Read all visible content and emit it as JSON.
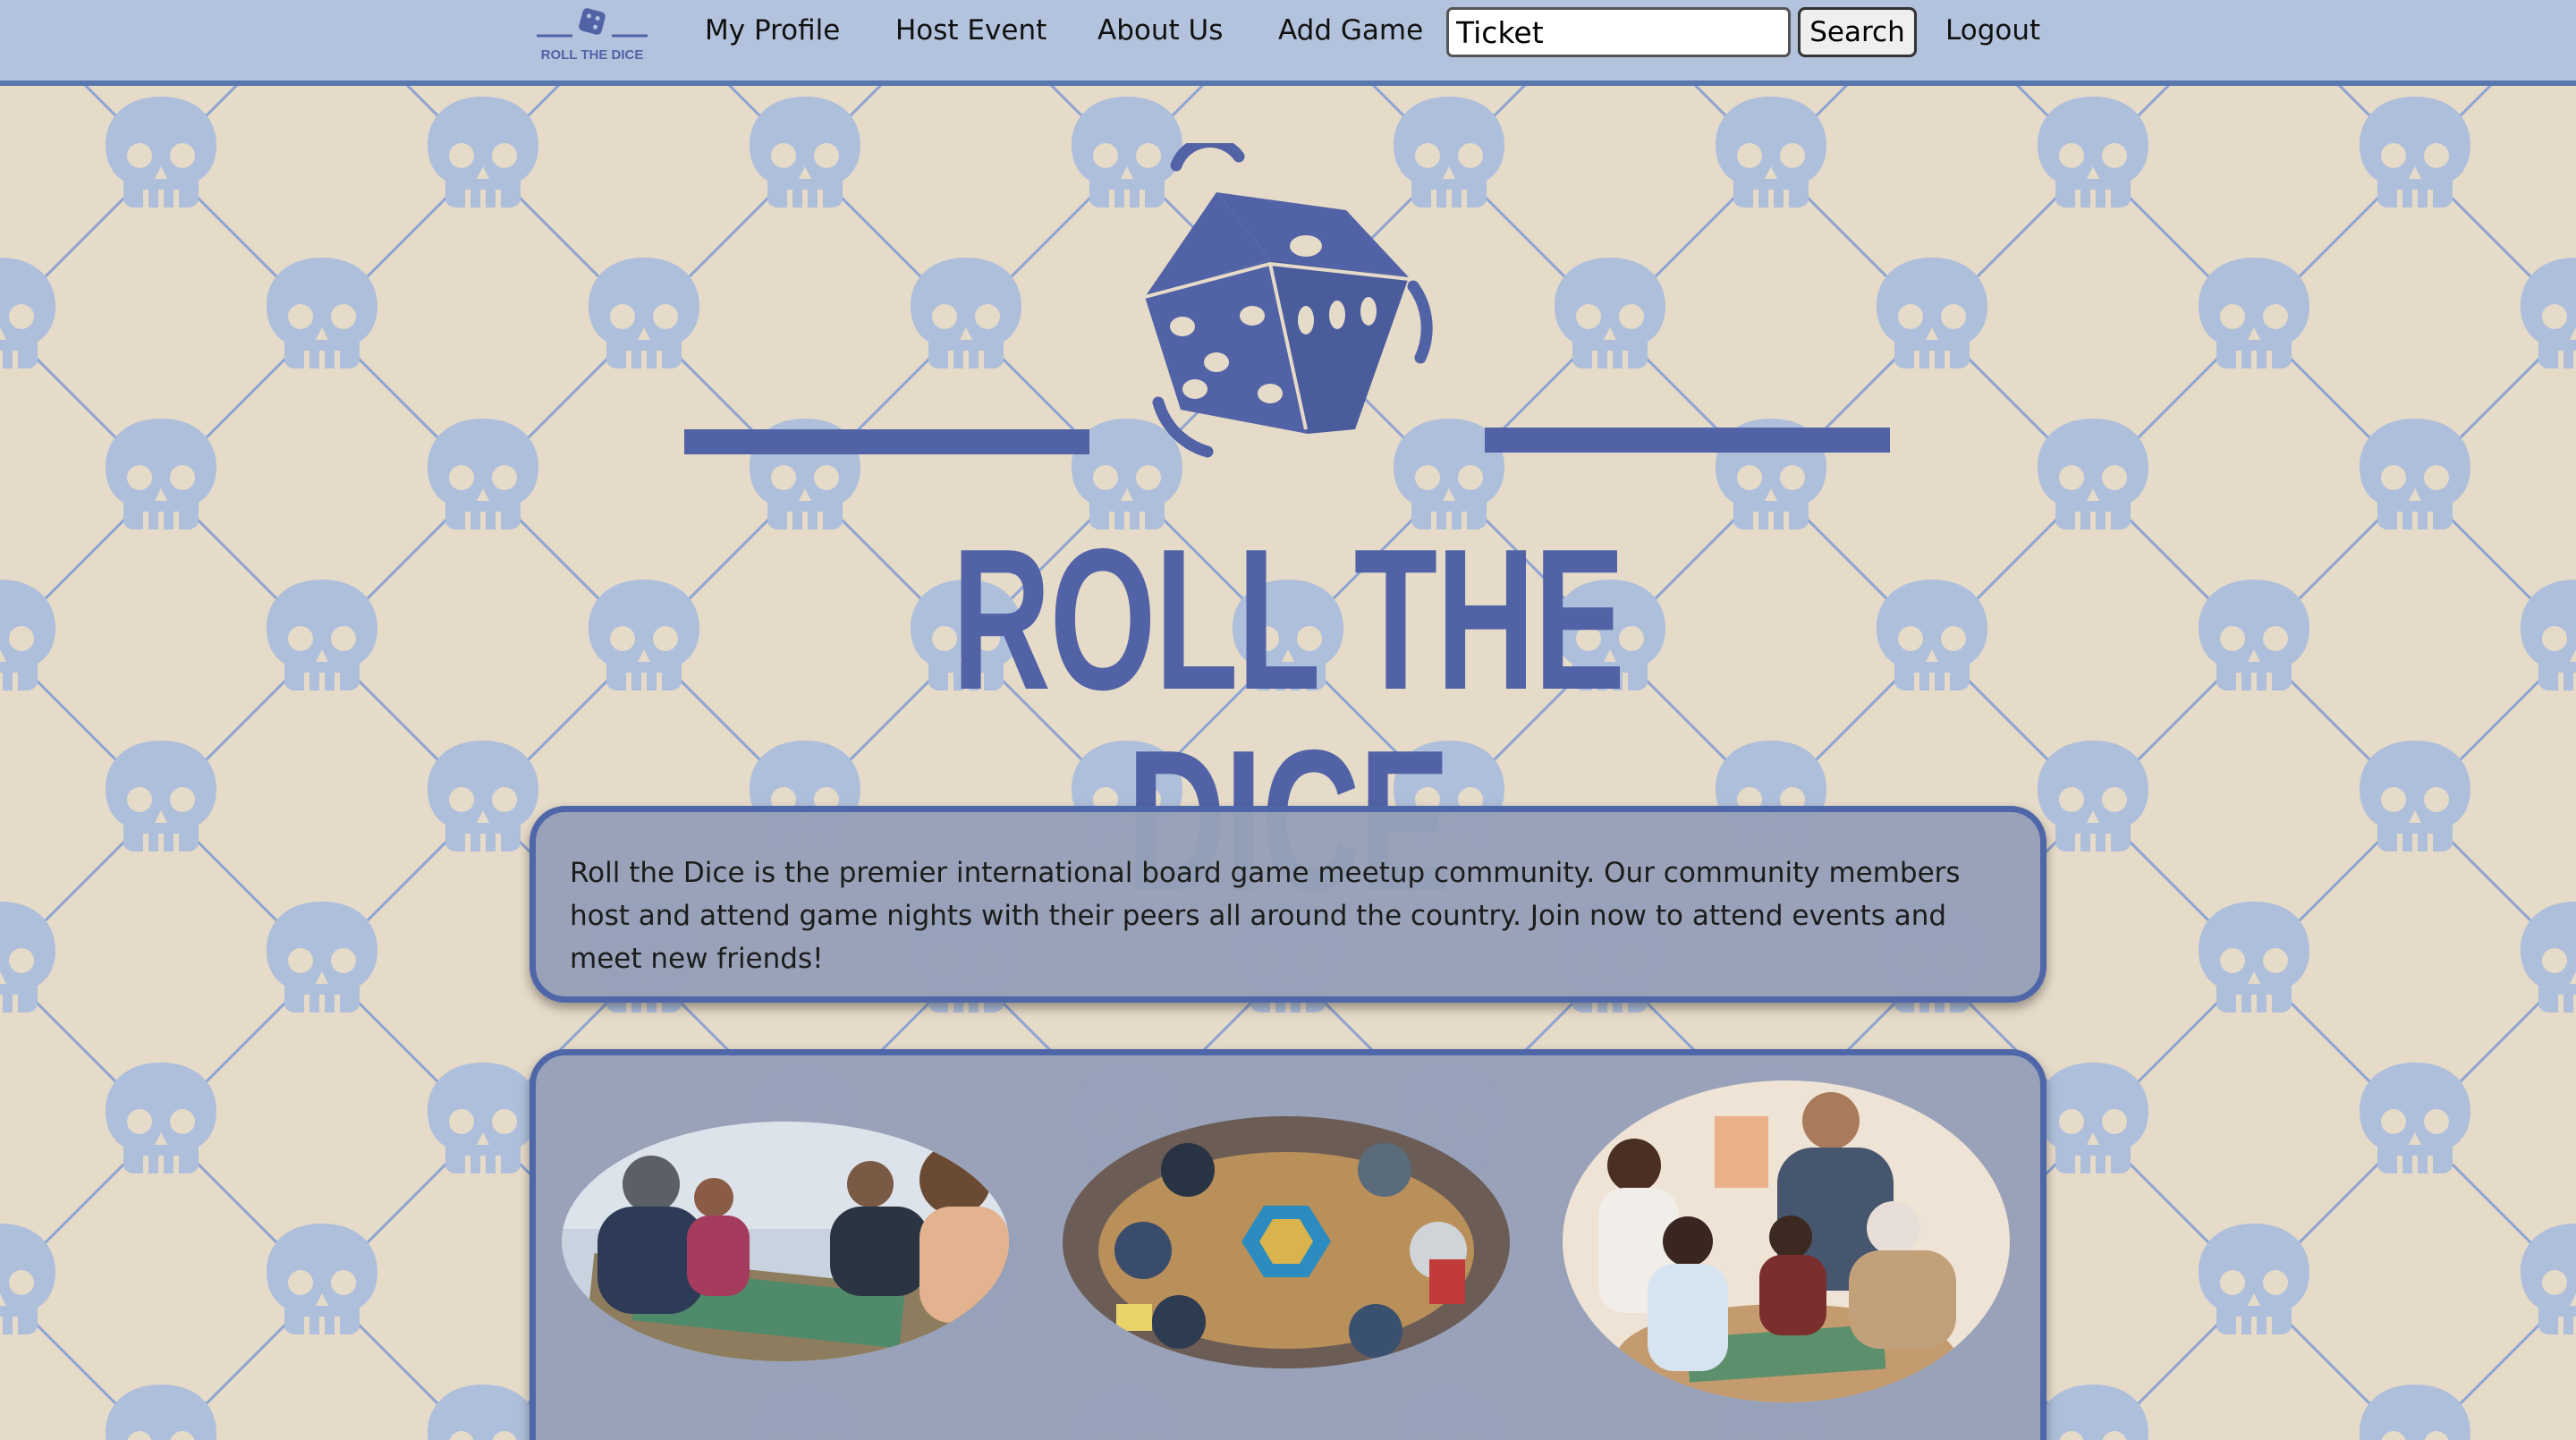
{
  "page_title": "Roll the Dice",
  "nav": {
    "logo_text": "ROLL THE DICE",
    "links": {
      "my_profile": "My Profile",
      "host_event": "Host Event",
      "about_us": "About Us",
      "add_game": "Add Game",
      "logout": "Logout"
    },
    "search_value": "Ticket",
    "search_button": "Search"
  },
  "hero": {
    "title": "ROLL THE DICE"
  },
  "about": {
    "text": "Roll the Dice is the premier international board game meetup community. Our community members host and attend game nights with their peers all around the country. Join now to attend events and meet new friends!"
  },
  "colors": {
    "navbar": "#b3c3dd",
    "brand_blue": "#5163a6",
    "background": "#e6dac9",
    "panel": "#969fb8",
    "panel_border": "#4f67a8"
  }
}
